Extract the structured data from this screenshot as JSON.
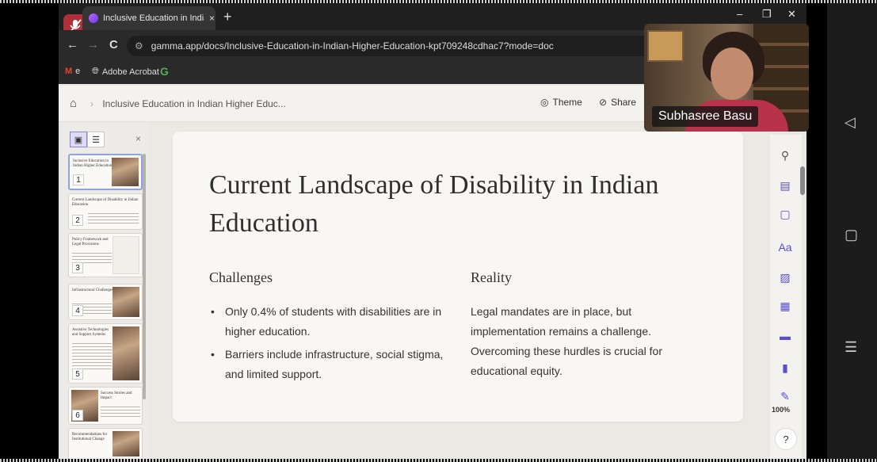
{
  "browser": {
    "tab_title": "Inclusive Education in Indian Hi",
    "tab_close": "×",
    "new_tab": "+",
    "url": "gamma.app/docs/Inclusive-Education-in-Indian-Higher-Education-kpt709248cdhac7?mode=doc",
    "win_min": "–",
    "win_max": "❐",
    "win_close": "✕",
    "back": "←",
    "forward": "→",
    "reload": "C",
    "bookmarks": [
      "e",
      "Adobe Acrobat"
    ]
  },
  "header": {
    "breadcrumb": "Inclusive Education in Indian Higher Educ...",
    "theme_label": "Theme",
    "share_label": "Share"
  },
  "sidebar": {
    "close": "×",
    "thumbnails": [
      {
        "num": "1",
        "title": "Inclusive Education in Indian Higher Education"
      },
      {
        "num": "2",
        "title": "Current Landscape of Disability in Indian Education"
      },
      {
        "num": "3",
        "title": "Policy Framework and Legal Provisions"
      },
      {
        "num": "4",
        "title": "Infrastructural Challenges"
      },
      {
        "num": "5",
        "title": "Assistive Technologies and Support Systems"
      },
      {
        "num": "6",
        "title": "Success Stories and Impact"
      },
      {
        "num": "",
        "title": "Recommendations for Institutional Change"
      }
    ]
  },
  "slide": {
    "title": "Current Landscape of Disability in Indian Education",
    "left_heading": "Challenges",
    "bullets": [
      "Only 0.4% of students with disabilities are in higher education.",
      "Barriers include infrastructure, social stigma, and limited support."
    ],
    "right_heading": "Reality",
    "right_text": "Legal mandates are in place, but implementation remains a challenge. Overcoming these hurdles is crucial for educational equity."
  },
  "tools": {
    "zoom": "100%",
    "help": "?"
  },
  "video": {
    "participant": "Subhasree Basu"
  }
}
